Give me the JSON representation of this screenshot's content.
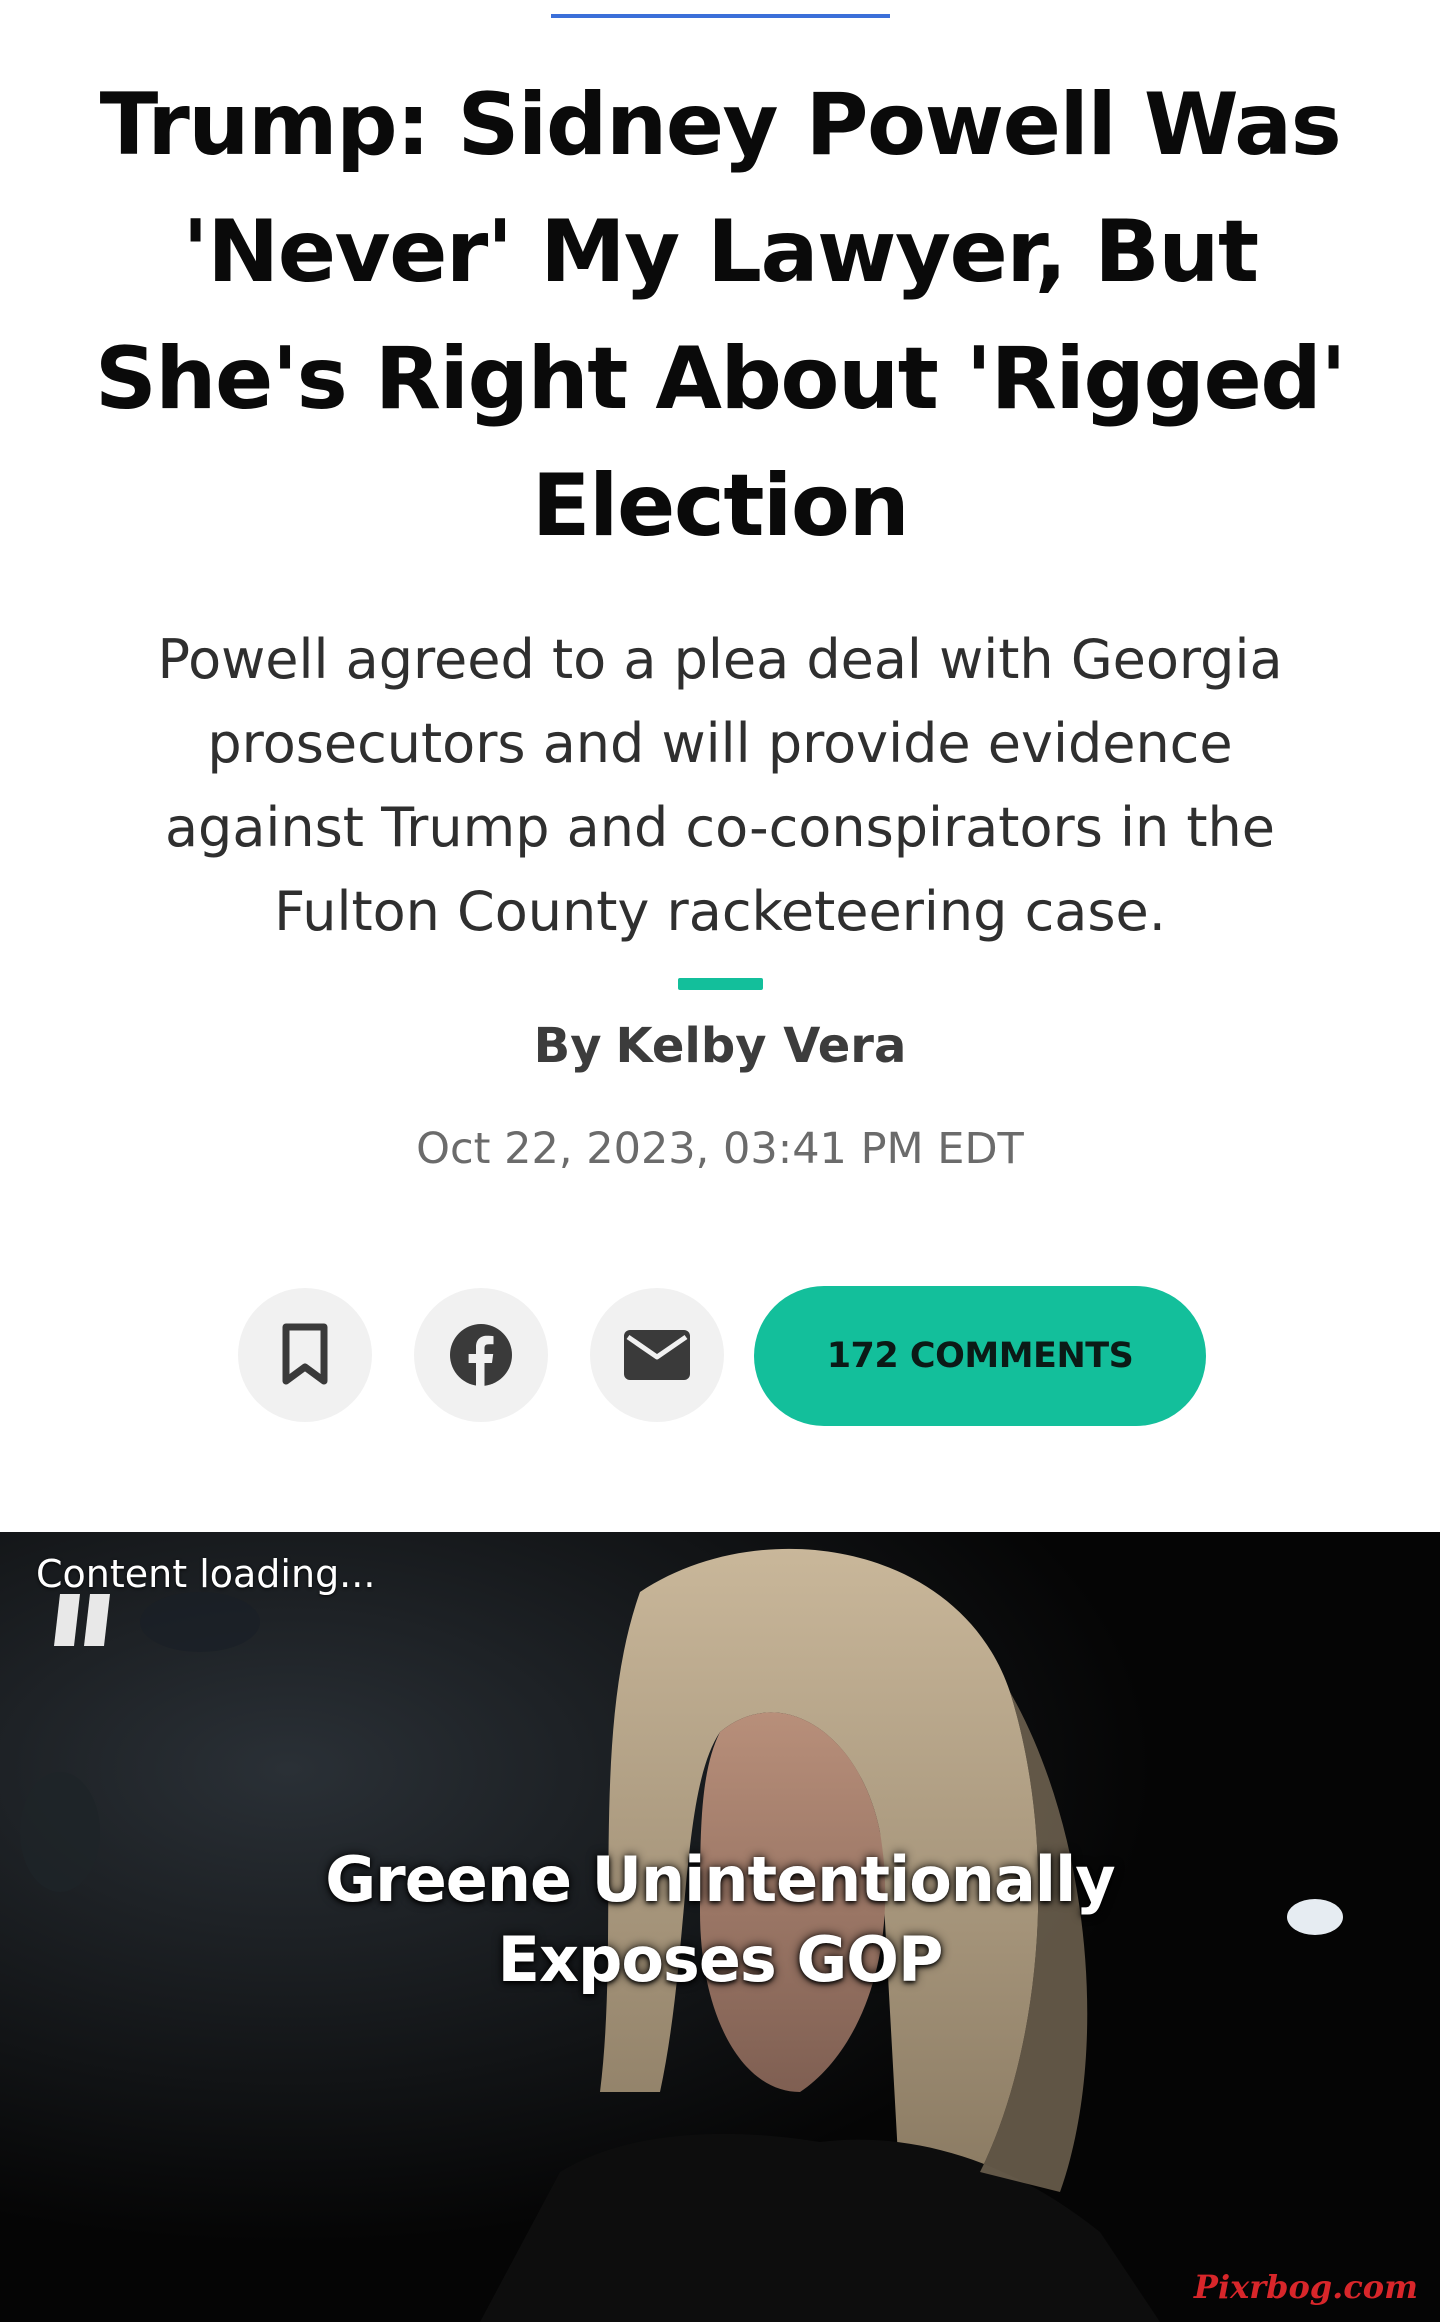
{
  "article": {
    "headline_lines": [
      "Trump: Sidney Powell Was",
      "'Never' My Lawyer, But",
      "She's Right About 'Rigged'",
      "Election"
    ],
    "dek_lines": [
      "Powell agreed to a plea deal with Georgia",
      "prosecutors and will provide evidence",
      "against Trump and co-conspirators in the",
      "Fulton County racketeering case."
    ],
    "byline_prefix": "By",
    "author": "Kelby Vera",
    "timestamp": "Oct 22, 2023, 03:41 PM EDT"
  },
  "actions": {
    "bookmark_icon": "bookmark-icon",
    "facebook_icon": "facebook-icon",
    "email_icon": "email-icon",
    "comments_label": "172 COMMENTS"
  },
  "video": {
    "status": "Content loading...",
    "caption_lines": [
      "Greene Unintentionally",
      "Exposes GOP"
    ],
    "watermark": "Pixrbog.com"
  },
  "colors": {
    "accent": "#13bf9b",
    "top_rule": "#3b6fd9",
    "button_bg": "#f1f1f1"
  }
}
